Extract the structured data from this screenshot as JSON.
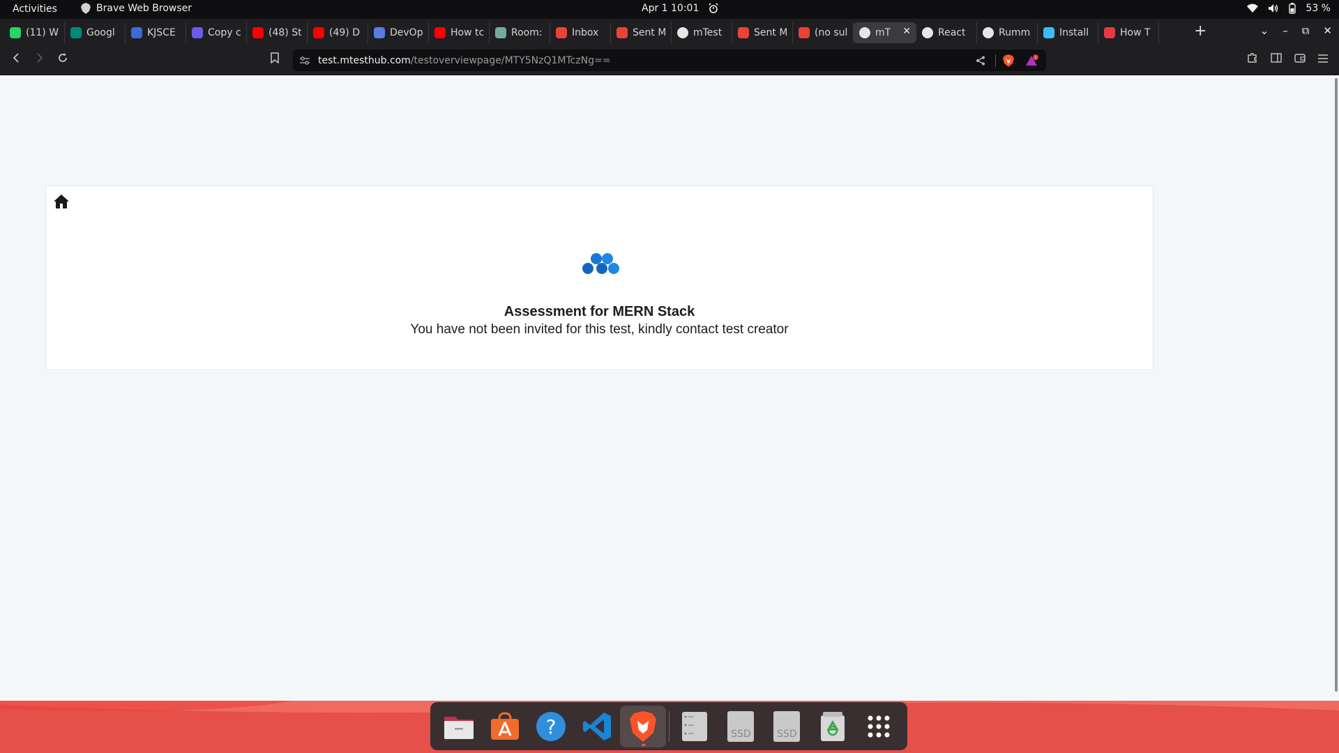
{
  "topbar": {
    "activities": "Activities",
    "app_name": "Brave Web Browser",
    "clock": "Apr 1  10:01",
    "battery": "53 %"
  },
  "tabs": [
    {
      "title": "(11) W",
      "icon": "whatsapp-icon",
      "color": "#25d366"
    },
    {
      "title": "Googl",
      "icon": "google-meet-icon",
      "color": "#00897b"
    },
    {
      "title": "KJSCE",
      "icon": "bookmark-blue-icon",
      "color": "#3a6bd6"
    },
    {
      "title": "Copy c",
      "icon": "drive-icon",
      "color": "#6b5ce7"
    },
    {
      "title": "(48) St",
      "icon": "youtube-icon",
      "color": "#ff0000"
    },
    {
      "title": "(49) D",
      "icon": "youtube-icon",
      "color": "#ff0000"
    },
    {
      "title": "DevOp",
      "icon": "image-icon",
      "color": "#5a7be0"
    },
    {
      "title": "How tc",
      "icon": "youtube-icon",
      "color": "#ff0000"
    },
    {
      "title": "Room:",
      "icon": "chatgpt-icon",
      "color": "#74aa9c"
    },
    {
      "title": "Inbox",
      "icon": "gmail-icon",
      "color": "#ea4335"
    },
    {
      "title": "Sent M",
      "icon": "gmail-icon",
      "color": "#ea4335"
    },
    {
      "title": "mTest",
      "icon": "globe-icon",
      "color": "#e6e6e6"
    },
    {
      "title": "Sent M",
      "icon": "gmail-icon",
      "color": "#ea4335"
    },
    {
      "title": "(no sul",
      "icon": "gmail-icon",
      "color": "#ea4335"
    },
    {
      "title": "mT",
      "icon": "globe-icon",
      "color": "#e6e6e6",
      "active": true
    },
    {
      "title": "React",
      "icon": "info-icon",
      "color": "#e6e6e6"
    },
    {
      "title": "Rumm",
      "icon": "github-icon",
      "color": "#e6e6e6"
    },
    {
      "title": "Install",
      "icon": "tailwind-icon",
      "color": "#38bdf8"
    },
    {
      "title": "How T",
      "icon": "t-logo-icon",
      "color": "#e53945"
    }
  ],
  "address": {
    "host": "test.mtesthub.com",
    "path": "/testoverviewpage/MTY5NzQ1MTczNg=="
  },
  "page": {
    "title": "Assessment for MERN Stack",
    "message": "You have not been invited for this test, kindly contact test creator"
  },
  "dock": {
    "ssd1": "SSD",
    "ssd2": "SSD"
  },
  "colors": {
    "brand_blue": "#1a73c8",
    "dock_red": "#e5504a",
    "brave_orange": "#fb542b"
  }
}
